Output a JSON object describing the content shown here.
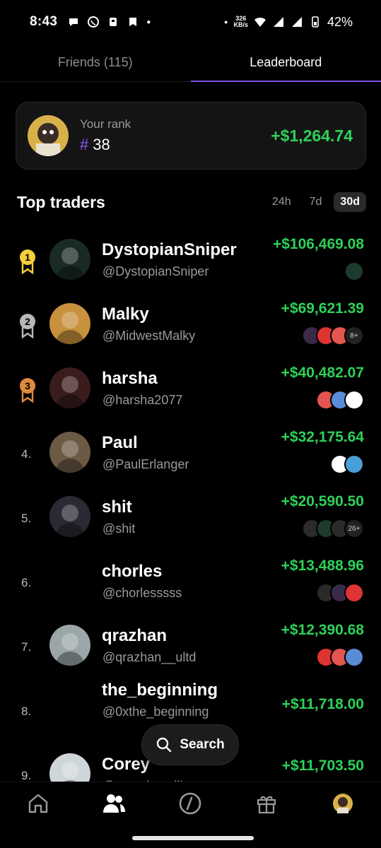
{
  "status": {
    "time": "8:43",
    "net_speed_value": "326",
    "net_speed_unit": "KB/s",
    "battery": "42%"
  },
  "tabs": [
    {
      "label": "Friends (115)",
      "active": false
    },
    {
      "label": "Leaderboard",
      "active": true
    }
  ],
  "your_rank": {
    "label": "Your rank",
    "hash": "#",
    "rank": "38",
    "gain": "+$1,264.74"
  },
  "top_traders": {
    "title": "Top traders",
    "periods": [
      "24h",
      "7d",
      "30d"
    ],
    "active_period": "30d"
  },
  "traders": [
    {
      "rank": "1",
      "badge": "gold",
      "name": "DystopianSniper",
      "handle": "@DystopianSniper",
      "gain": "+$106,469.08",
      "holdings": [
        "token-icon"
      ],
      "more": ""
    },
    {
      "rank": "2",
      "badge": "silver",
      "name": "Malky",
      "handle": "@MidwestMalky",
      "gain": "+$69,621.39",
      "holdings": [
        "token-icon",
        "token-icon",
        "token-icon"
      ],
      "more": "8+"
    },
    {
      "rank": "3",
      "badge": "bronze",
      "name": "harsha",
      "handle": "@harsha2077",
      "gain": "+$40,482.07",
      "holdings": [
        "token-icon",
        "token-icon",
        "token-icon"
      ],
      "more": ""
    },
    {
      "rank": "4.",
      "badge": "",
      "name": "Paul",
      "handle": "@PaulErlanger",
      "gain": "+$32,175.64",
      "holdings": [
        "token-icon",
        "token-icon"
      ],
      "more": ""
    },
    {
      "rank": "5.",
      "badge": "",
      "name": "shit",
      "handle": "@shit",
      "gain": "+$20,590.50",
      "holdings": [
        "token-icon",
        "token-icon",
        "token-icon"
      ],
      "more": "26+"
    },
    {
      "rank": "6.",
      "badge": "",
      "name": "chorles",
      "handle": "@chorlesssss",
      "gain": "+$13,488.96",
      "holdings": [
        "token-icon",
        "token-icon",
        "token-icon"
      ],
      "more": ""
    },
    {
      "rank": "7.",
      "badge": "",
      "name": "qrazhan",
      "handle": "@qrazhan__ultd",
      "gain": "+$12,390.68",
      "holdings": [
        "token-icon",
        "token-icon",
        "token-icon"
      ],
      "more": ""
    },
    {
      "rank": "8.",
      "badge": "",
      "name": "the_beginning",
      "handle": "@0xthe_beginning",
      "gain": "+$11,718.00",
      "holdings": [],
      "more": ""
    },
    {
      "rank": "9.",
      "badge": "",
      "name": "Corey",
      "handle": "@coreyj__miller",
      "gain": "+$11,703.50",
      "holdings": [
        "token-icon"
      ],
      "more": ""
    }
  ],
  "search": {
    "label": "Search"
  },
  "nav": [
    "home-icon",
    "friends-icon",
    "trade-icon",
    "gift-icon",
    "profile-avatar"
  ],
  "colors": {
    "accent": "#7b4ff0",
    "gain": "#2ed158",
    "gold": "#f2cf3c",
    "silver": "#b9b9b9",
    "bronze": "#e08a3c"
  }
}
